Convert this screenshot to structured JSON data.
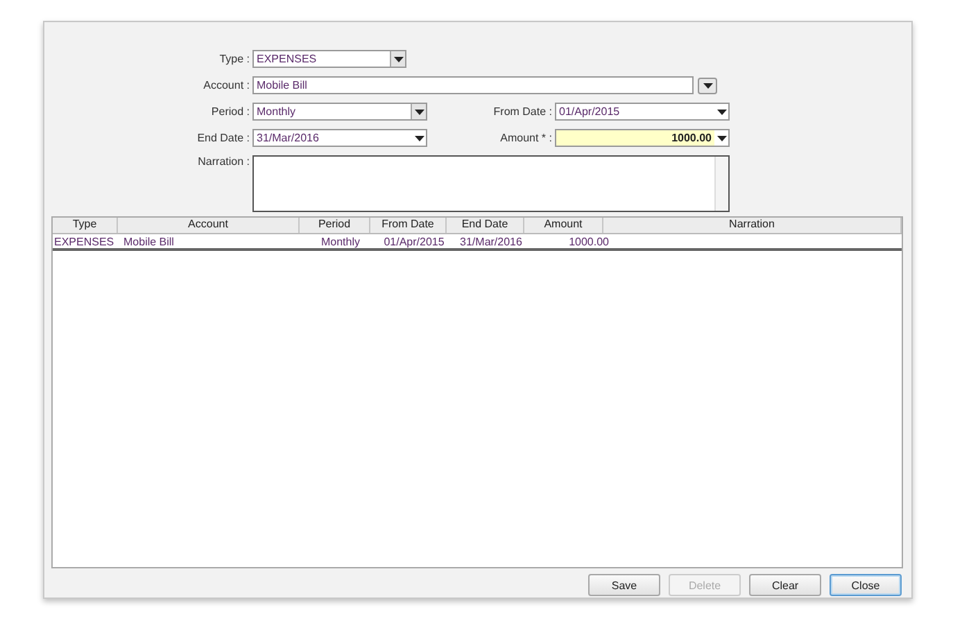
{
  "form": {
    "rows": [
      [
        {
          "label": "Type :",
          "kind": "select",
          "value": "EXPENSES",
          "highlighted": false
        }
      ],
      [
        {
          "label": "Account :",
          "kind": "combo",
          "value": "Mobile Bill",
          "highlighted": false
        }
      ],
      [
        {
          "label": "Period :",
          "kind": "dropdown",
          "value": "Monthly",
          "highlighted": false
        },
        {
          "label": "From Date :",
          "kind": "date",
          "value": "01/Apr/2015",
          "highlighted": false
        }
      ],
      [
        {
          "label": "End Date :",
          "kind": "date",
          "value": "31/Mar/2016",
          "highlighted": false
        },
        {
          "label": "Amount * :",
          "kind": "amount",
          "value": "1000.00",
          "highlighted": true
        }
      ],
      [
        {
          "label": "Narration :",
          "kind": "textarea",
          "highlighted": false
        }
      ]
    ]
  },
  "table": {
    "columns": [
      "Type",
      "Account",
      "Period",
      "From Date",
      "End Date",
      "Amount",
      "Narration"
    ],
    "rows": [
      [
        "EXPENSES",
        "Mobile Bill",
        "Monthly",
        "01/Apr/2015",
        "31/Mar/2016",
        "1000.00",
        ""
      ]
    ]
  },
  "buttons": [
    {
      "label": "Save",
      "disabled": false,
      "focused": false
    },
    {
      "label": "Delete",
      "disabled": true,
      "focused": false
    },
    {
      "label": "Clear",
      "disabled": false,
      "focused": false
    },
    {
      "label": "Close",
      "disabled": false,
      "focused": true
    }
  ]
}
